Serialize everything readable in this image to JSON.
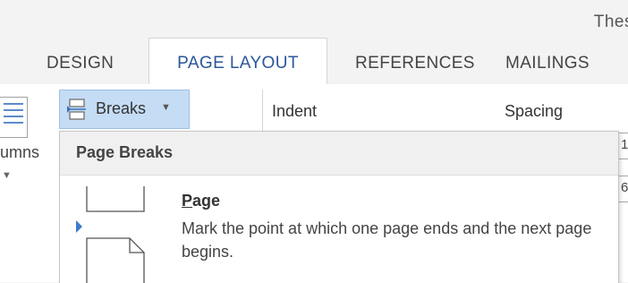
{
  "window": {
    "title_fragment": "Thes"
  },
  "tabs": [
    {
      "label": "DESIGN"
    },
    {
      "label": "PAGE LAYOUT",
      "active": true
    },
    {
      "label": "REFERENCES"
    },
    {
      "label": "MAILINGS"
    }
  ],
  "ribbon": {
    "columns_label": "umns",
    "breaks_label": "Breaks",
    "indent_label": "Indent",
    "spacing_label": "Spacing",
    "spacing_field_1": "1",
    "spacing_field_2": "6",
    "right_fragment": ":",
    "tiny_mark": "·"
  },
  "breaks_menu": {
    "header": "Page Breaks",
    "items": [
      {
        "title_accel": "P",
        "title_rest": "age",
        "description": "Mark the point at which one page ends and the next page begins.",
        "icon": "page-break-icon"
      }
    ]
  },
  "colors": {
    "accent": "#2b579a",
    "highlight": "#c5dcf5",
    "icon_blue": "#5b8bc9"
  }
}
